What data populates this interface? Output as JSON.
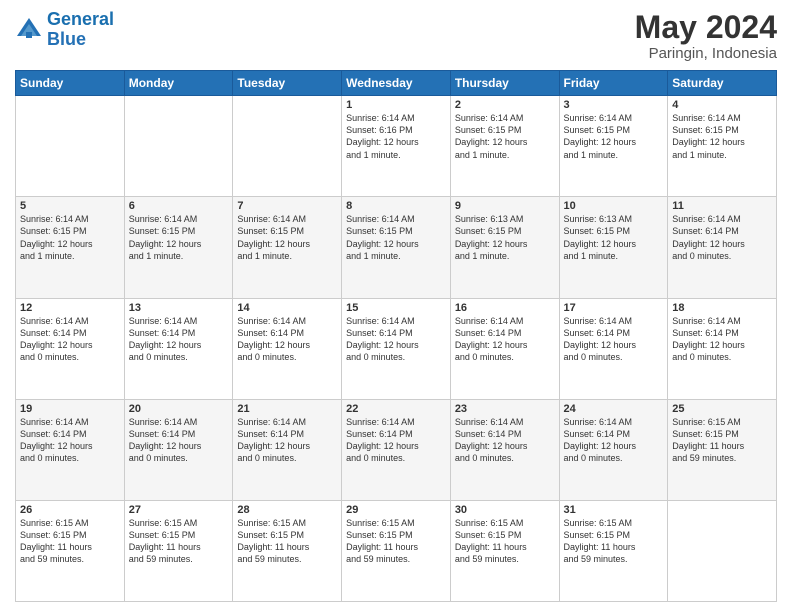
{
  "logo": {
    "line1": "General",
    "line2": "Blue"
  },
  "title": "May 2024",
  "location": "Paringin, Indonesia",
  "weekdays": [
    "Sunday",
    "Monday",
    "Tuesday",
    "Wednesday",
    "Thursday",
    "Friday",
    "Saturday"
  ],
  "weeks": [
    [
      {
        "day": "",
        "info": ""
      },
      {
        "day": "",
        "info": ""
      },
      {
        "day": "",
        "info": ""
      },
      {
        "day": "1",
        "info": "Sunrise: 6:14 AM\nSunset: 6:16 PM\nDaylight: 12 hours\nand 1 minute."
      },
      {
        "day": "2",
        "info": "Sunrise: 6:14 AM\nSunset: 6:15 PM\nDaylight: 12 hours\nand 1 minute."
      },
      {
        "day": "3",
        "info": "Sunrise: 6:14 AM\nSunset: 6:15 PM\nDaylight: 12 hours\nand 1 minute."
      },
      {
        "day": "4",
        "info": "Sunrise: 6:14 AM\nSunset: 6:15 PM\nDaylight: 12 hours\nand 1 minute."
      }
    ],
    [
      {
        "day": "5",
        "info": "Sunrise: 6:14 AM\nSunset: 6:15 PM\nDaylight: 12 hours\nand 1 minute."
      },
      {
        "day": "6",
        "info": "Sunrise: 6:14 AM\nSunset: 6:15 PM\nDaylight: 12 hours\nand 1 minute."
      },
      {
        "day": "7",
        "info": "Sunrise: 6:14 AM\nSunset: 6:15 PM\nDaylight: 12 hours\nand 1 minute."
      },
      {
        "day": "8",
        "info": "Sunrise: 6:14 AM\nSunset: 6:15 PM\nDaylight: 12 hours\nand 1 minute."
      },
      {
        "day": "9",
        "info": "Sunrise: 6:13 AM\nSunset: 6:15 PM\nDaylight: 12 hours\nand 1 minute."
      },
      {
        "day": "10",
        "info": "Sunrise: 6:13 AM\nSunset: 6:15 PM\nDaylight: 12 hours\nand 1 minute."
      },
      {
        "day": "11",
        "info": "Sunrise: 6:14 AM\nSunset: 6:14 PM\nDaylight: 12 hours\nand 0 minutes."
      }
    ],
    [
      {
        "day": "12",
        "info": "Sunrise: 6:14 AM\nSunset: 6:14 PM\nDaylight: 12 hours\nand 0 minutes."
      },
      {
        "day": "13",
        "info": "Sunrise: 6:14 AM\nSunset: 6:14 PM\nDaylight: 12 hours\nand 0 minutes."
      },
      {
        "day": "14",
        "info": "Sunrise: 6:14 AM\nSunset: 6:14 PM\nDaylight: 12 hours\nand 0 minutes."
      },
      {
        "day": "15",
        "info": "Sunrise: 6:14 AM\nSunset: 6:14 PM\nDaylight: 12 hours\nand 0 minutes."
      },
      {
        "day": "16",
        "info": "Sunrise: 6:14 AM\nSunset: 6:14 PM\nDaylight: 12 hours\nand 0 minutes."
      },
      {
        "day": "17",
        "info": "Sunrise: 6:14 AM\nSunset: 6:14 PM\nDaylight: 12 hours\nand 0 minutes."
      },
      {
        "day": "18",
        "info": "Sunrise: 6:14 AM\nSunset: 6:14 PM\nDaylight: 12 hours\nand 0 minutes."
      }
    ],
    [
      {
        "day": "19",
        "info": "Sunrise: 6:14 AM\nSunset: 6:14 PM\nDaylight: 12 hours\nand 0 minutes."
      },
      {
        "day": "20",
        "info": "Sunrise: 6:14 AM\nSunset: 6:14 PM\nDaylight: 12 hours\nand 0 minutes."
      },
      {
        "day": "21",
        "info": "Sunrise: 6:14 AM\nSunset: 6:14 PM\nDaylight: 12 hours\nand 0 minutes."
      },
      {
        "day": "22",
        "info": "Sunrise: 6:14 AM\nSunset: 6:14 PM\nDaylight: 12 hours\nand 0 minutes."
      },
      {
        "day": "23",
        "info": "Sunrise: 6:14 AM\nSunset: 6:14 PM\nDaylight: 12 hours\nand 0 minutes."
      },
      {
        "day": "24",
        "info": "Sunrise: 6:14 AM\nSunset: 6:14 PM\nDaylight: 12 hours\nand 0 minutes."
      },
      {
        "day": "25",
        "info": "Sunrise: 6:15 AM\nSunset: 6:15 PM\nDaylight: 11 hours\nand 59 minutes."
      }
    ],
    [
      {
        "day": "26",
        "info": "Sunrise: 6:15 AM\nSunset: 6:15 PM\nDaylight: 11 hours\nand 59 minutes."
      },
      {
        "day": "27",
        "info": "Sunrise: 6:15 AM\nSunset: 6:15 PM\nDaylight: 11 hours\nand 59 minutes."
      },
      {
        "day": "28",
        "info": "Sunrise: 6:15 AM\nSunset: 6:15 PM\nDaylight: 11 hours\nand 59 minutes."
      },
      {
        "day": "29",
        "info": "Sunrise: 6:15 AM\nSunset: 6:15 PM\nDaylight: 11 hours\nand 59 minutes."
      },
      {
        "day": "30",
        "info": "Sunrise: 6:15 AM\nSunset: 6:15 PM\nDaylight: 11 hours\nand 59 minutes."
      },
      {
        "day": "31",
        "info": "Sunrise: 6:15 AM\nSunset: 6:15 PM\nDaylight: 11 hours\nand 59 minutes."
      },
      {
        "day": "",
        "info": ""
      }
    ]
  ]
}
